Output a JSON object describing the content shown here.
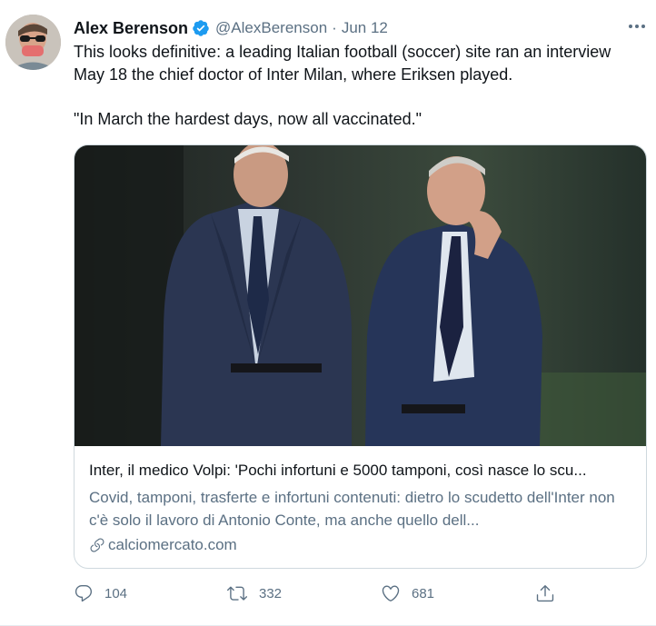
{
  "tweet": {
    "author_name": "Alex Berenson",
    "handle": "@AlexBerenson",
    "separator": "·",
    "date": "Jun 12",
    "text_line_1": "This looks definitive: a leading Italian football (soccer) site ran an interview May 18 the chief doctor of Inter Milan, where Eriksen played.",
    "text_line_2": "\"In March the hardest days, now all vaccinated.\"",
    "verified_color": "#1d9bf0"
  },
  "card": {
    "title": "Inter, il medico Volpi: 'Pochi infortuni e 5000 tamponi, così nasce lo scu...",
    "description": "Covid, tamponi, trasferte e infortuni contenuti: dietro lo scudetto dell'Inter non c'è solo il lavoro di Antonio Conte, ma anche quello dell...",
    "domain": "calciomercato.com",
    "image_icon": "photo-two-men-in-suits"
  },
  "actions": {
    "reply_count": "104",
    "retweet_count": "332",
    "like_count": "681",
    "reply_icon": "reply-icon",
    "retweet_icon": "retweet-icon",
    "like_icon": "heart-icon",
    "share_icon": "share-icon"
  }
}
